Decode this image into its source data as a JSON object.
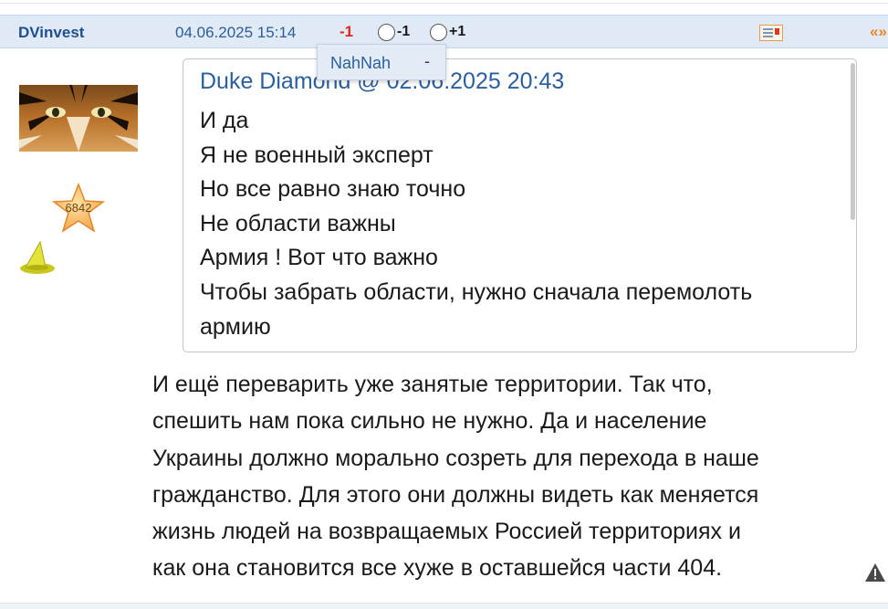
{
  "header": {
    "author": "DVinvest",
    "date": "04.06.2025 15:14",
    "rating": "-1",
    "vote_minus_label": "-1",
    "vote_plus_label": "+1",
    "quote_arrows": "«»"
  },
  "user": {
    "star_count": "6842"
  },
  "tooltip": {
    "voter": "NahNah",
    "vote_value": "-"
  },
  "quote": {
    "header": "Duke Diamond @ 02.06.2025 20:43",
    "lines": [
      "И да",
      "Я не военный эксперт",
      "Но все равно знаю точно",
      "Не области важны",
      "Армия ! Вот что важно",
      "Чтобы забрать области, нужно сначала перемолоть",
      "армию"
    ]
  },
  "body": {
    "lines": [
      "И ещё переварить уже занятые территории. Так что,",
      "спешить нам пока сильно не нужно. Да и население",
      "Украины должно морально созреть для перехода в наше",
      "гражданство. Для этого они должны видеть как меняется",
      "жизнь людей на возвращаемых Россией территориях и",
      "как она становится все хуже в оставшейся части 404."
    ]
  },
  "colors": {
    "header_bg": "#dfeaf6",
    "author": "#1e4f8e",
    "rating_negative": "#e0261d",
    "quote_author": "#2b5f9e",
    "quote_arrows": "#e8832a"
  },
  "icons": {
    "message": "message-icon",
    "star": "star-badge-icon",
    "hat": "wizard-hat-icon",
    "report": "warning-icon"
  }
}
